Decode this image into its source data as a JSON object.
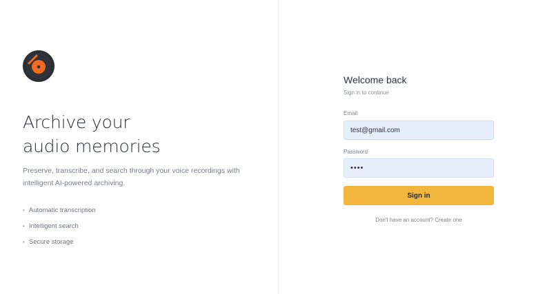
{
  "brand": {
    "logo_icon": "vinyl-record-icon",
    "accent_color": "#f36a1f",
    "dark_color": "#2d2f36"
  },
  "hero": {
    "headline_line1": "Archive your",
    "headline_line2": "audio memories",
    "description": "Preserve, transcribe, and search through your voice recordings with intelligent AI-powered archiving.",
    "features": [
      "Automatic transcription",
      "Intelligent search",
      "Secure storage"
    ],
    "bullet": "•"
  },
  "login": {
    "title": "Welcome back",
    "subtitle": "Sign in to continue",
    "email_label": "Email",
    "email_value": "test@gmail.com",
    "password_label": "Password",
    "password_value": "test",
    "submit_label": "Sign in",
    "signup_prompt": "Don't have an account?",
    "signup_link": "Create one"
  },
  "colors": {
    "button": "#f3b63d",
    "input_bg": "#e8effc"
  }
}
